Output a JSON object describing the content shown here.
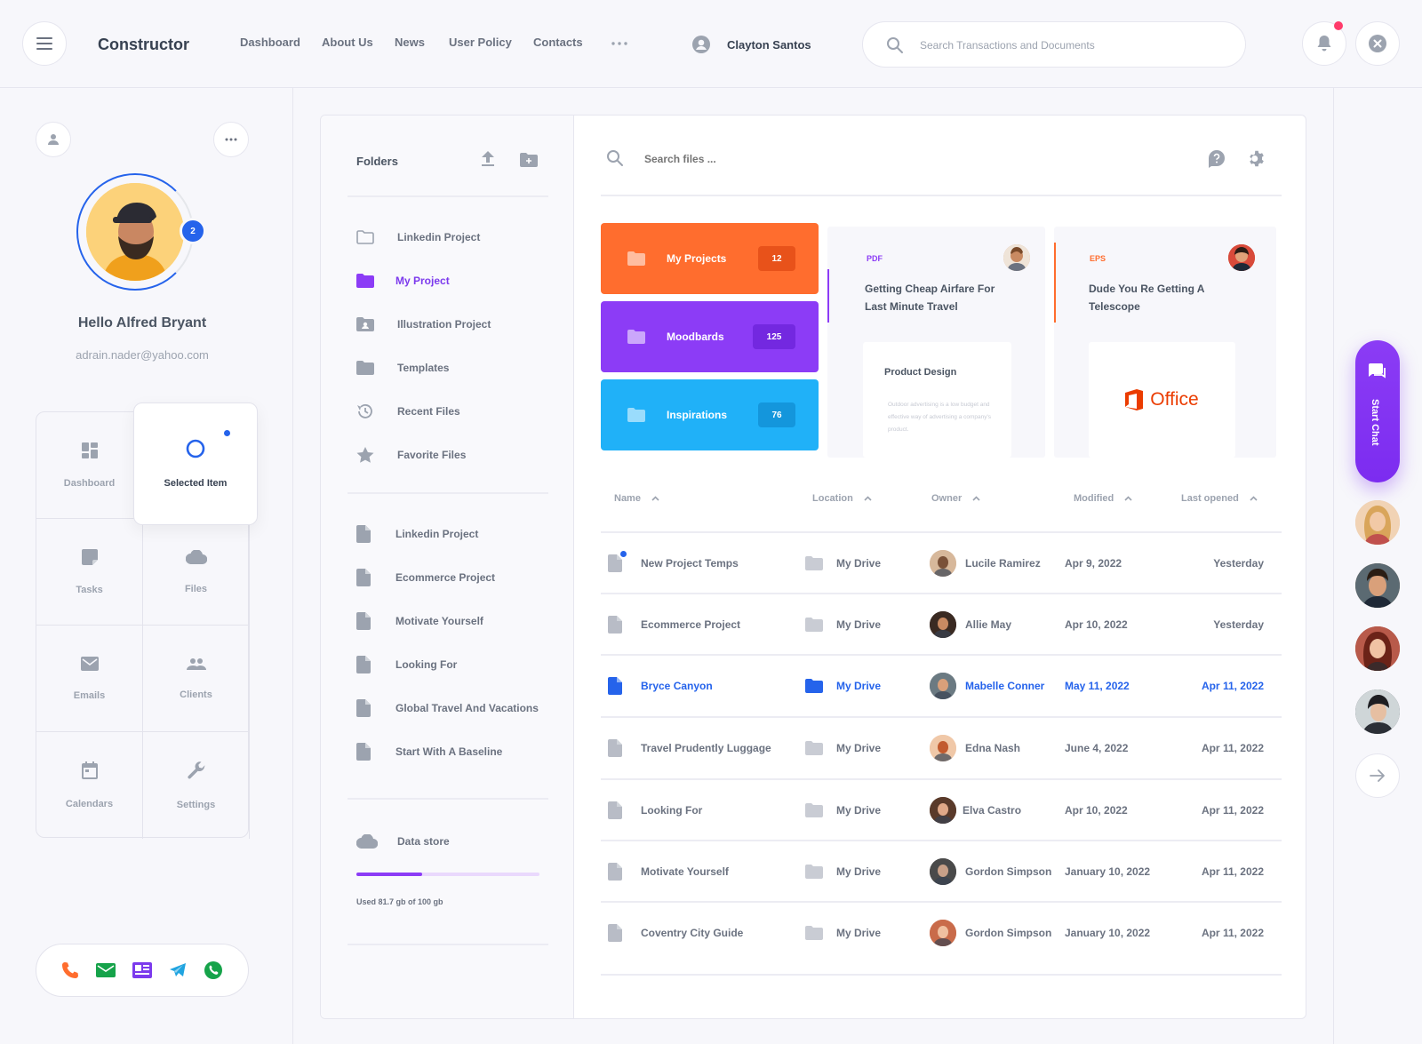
{
  "header": {
    "brand": "Constructor",
    "nav": [
      "Dashboard",
      "About Us",
      "News",
      "User Policy",
      "Contacts"
    ],
    "user_name": "Clayton Santos",
    "search_placeholder": "Search Transactions and Documents"
  },
  "profile": {
    "badge_count": "2",
    "greeting": "Hello Alfred Bryant",
    "email": "adrain.nader@yahoo.com"
  },
  "menu": {
    "dashboard": "Dashboard",
    "selected": "Selected Item",
    "tasks": "Tasks",
    "files": "Files",
    "emails": "Emails",
    "clients": "Clients",
    "calendars": "Calendars",
    "settings": "Settings"
  },
  "folders": {
    "title": "Folders",
    "group1": [
      "Linkedin Project",
      "My Project",
      "Illustration Project",
      "Templates",
      "Recent Files",
      "Favorite Files"
    ],
    "group2": [
      "Linkedin Project",
      "Ecommerce Project",
      "Motivate Yourself",
      "Looking For",
      "Global Travel And Vacations",
      "Start With A Baseline"
    ],
    "storage_label": "Data store",
    "storage_used": 0.817,
    "storage_text": "Used 81.7 gb of 100 gb"
  },
  "content": {
    "search_placeholder": "Search files ...",
    "tiles": [
      {
        "label": "My Projects",
        "count": "12",
        "color": "#ff6d2e"
      },
      {
        "label": "Moodbards",
        "count": "125",
        "color": "#8c3cf6"
      },
      {
        "label": "Inspirations",
        "count": "76",
        "color": "#20b1f8"
      }
    ],
    "cards": [
      {
        "type": "PDF",
        "title": "Getting Cheap Airfare For Last Minute Travel",
        "inner_title": "Product Design",
        "inner_text": "Outdoor advertising is a low budget and effective way of advertising a company's product.",
        "accent": "#8c3cf6"
      },
      {
        "type": "EPS",
        "title": "Dude You Re Getting A Telescope",
        "inner_logo": "Office",
        "accent": "#ff6d2e"
      }
    ],
    "columns": [
      "Name",
      "Location",
      "Owner",
      "Modified",
      "Last opened"
    ],
    "rows": [
      {
        "name": "New Project Temps",
        "location": "My Drive",
        "owner": "Lucile Ramirez",
        "modified": "Apr 9, 2022",
        "opened": "Yesterday"
      },
      {
        "name": "Ecommerce Project",
        "location": "My Drive",
        "owner": "Allie May",
        "modified": "Apr 10, 2022",
        "opened": "Yesterday"
      },
      {
        "name": "Bryce Canyon",
        "location": "My Drive",
        "owner": "Mabelle Conner",
        "modified": "May 11, 2022",
        "opened": "Apr 11, 2022"
      },
      {
        "name": "Travel Prudently Luggage",
        "location": "My Drive",
        "owner": "Edna Nash",
        "modified": "June 4, 2022",
        "opened": "Apr 11, 2022"
      },
      {
        "name": "Looking For",
        "location": "My Drive",
        "owner": "Elva Castro",
        "modified": "Apr 10, 2022",
        "opened": "Apr 11, 2022"
      },
      {
        "name": "Motivate Yourself",
        "location": "My Drive",
        "owner": "Gordon Simpson",
        "modified": "January 10, 2022",
        "opened": "Apr 11, 2022"
      },
      {
        "name": "Coventry City Guide",
        "location": "My Drive",
        "owner": "Gordon Simpson",
        "modified": "January 10, 2022",
        "opened": "Apr 11, 2022"
      }
    ]
  },
  "chat": {
    "label": "Start Chat"
  },
  "colors": {
    "accent_purple": "#8c3cf6",
    "accent_orange": "#ff6d2e",
    "accent_blue": "#2563eb",
    "sky": "#20b1f8"
  }
}
